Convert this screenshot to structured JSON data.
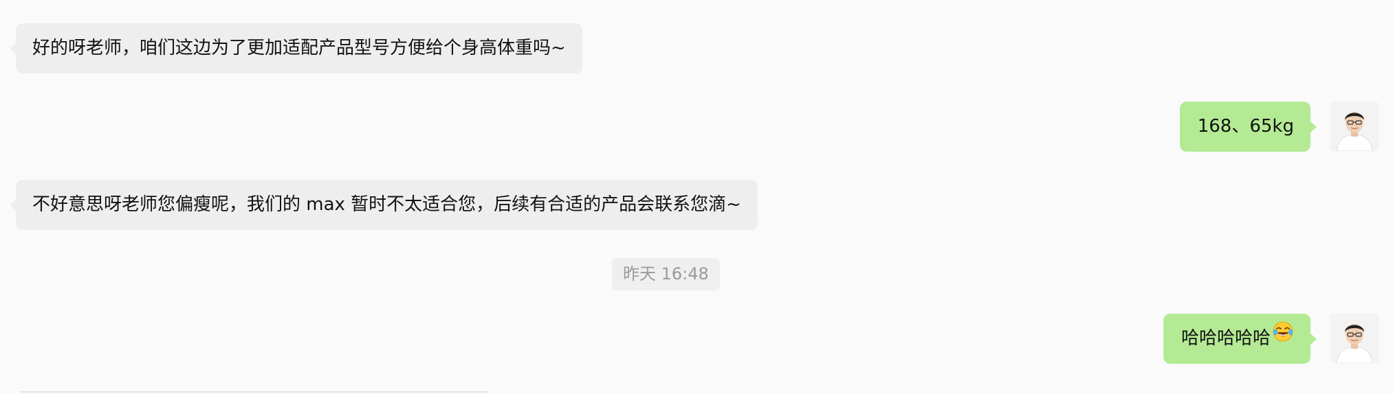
{
  "messages": [
    {
      "direction": "in",
      "text": "好的呀老师，咱们这边为了更加适配产品型号方便给个身高体重吗~"
    },
    {
      "direction": "out",
      "text": "168、65kg"
    },
    {
      "direction": "in",
      "text": "不好意思呀老师您偏瘦呢，我们的 max 暂时不太适合您，后续有合适的产品会联系您滴~"
    },
    {
      "direction": "out",
      "text": "哈哈哈哈哈",
      "emoji": "tears-of-joy-emoji"
    }
  ],
  "timestamp": "昨天 16:48",
  "colors": {
    "background": "#fafafa",
    "incoming_bubble": "#eeeeee",
    "outgoing_bubble": "#b4ea94",
    "timestamp_text": "#9a9a9a"
  },
  "icons": {
    "self_avatar": "user-avatar-icon"
  }
}
